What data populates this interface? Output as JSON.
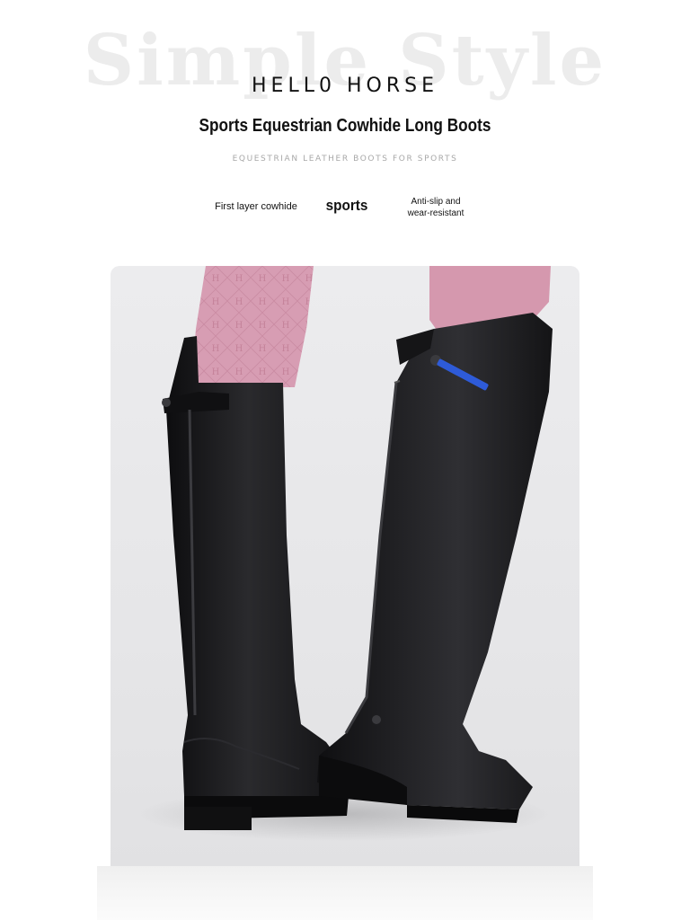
{
  "header": {
    "watermark": "Simple Style",
    "brand": "HELL0 HORSE",
    "title": "Sports Equestrian Cowhide Long Boots",
    "subtitle": "EQUESTRIAN LEATHER BOOTS FOR SPORTS"
  },
  "features": [
    {
      "label": "First layer cowhide"
    },
    {
      "label": "sports"
    },
    {
      "label_line1": "Anti-slip and",
      "label_line2": "wear-resistant"
    }
  ],
  "colors": {
    "leather": "#1b1b1d",
    "breeches": "#d59ab0",
    "accent_blue": "#2e5bd8",
    "background": "#ebebed"
  },
  "icons": {
    "product_photo": "black-riding-boots-photo"
  }
}
